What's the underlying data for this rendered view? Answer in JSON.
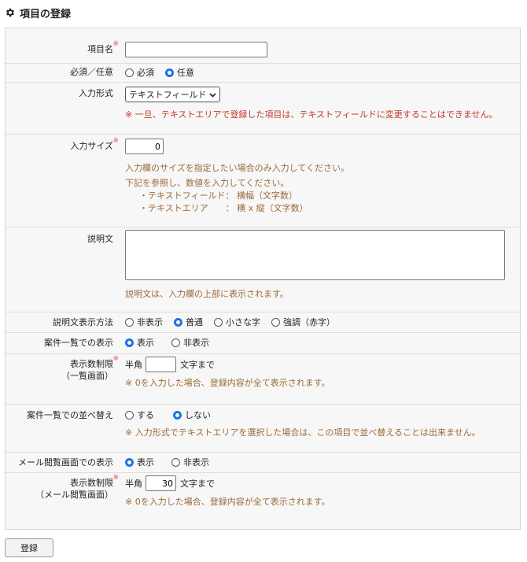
{
  "page": {
    "title": "項目の登録",
    "icon": "gear-icon"
  },
  "required_mark": "※",
  "fields": {
    "item_name": {
      "label": "項目名",
      "value": ""
    },
    "required_optional": {
      "label": "必須／任意",
      "options": [
        "必須",
        "任意"
      ],
      "selected": "任意"
    },
    "input_type": {
      "label": "入力形式",
      "selected": "テキストフィールド",
      "note": "※ 一旦、テキストエリアで登録した項目は、テキストフィールドに変更することはできません。"
    },
    "input_size": {
      "label": "入力サイズ",
      "value": "0",
      "note": "入力欄のサイズを指定したい場合のみ入力してください。",
      "help": "下記を参照し、数値を入力してください。",
      "help_lines": [
        "・テキストフィールド： 横幅（文字数）",
        "・テキストエリア　　： 横 x 縦（文字数）"
      ]
    },
    "description": {
      "label": "説明文",
      "value": "",
      "note": "説明文は、入力欄の上部に表示されます。"
    },
    "description_display": {
      "label": "説明文表示方法",
      "options": [
        "非表示",
        "普通",
        "小さな字",
        "強調（赤字）"
      ],
      "selected": "普通"
    },
    "list_display": {
      "label": "案件一覧での表示",
      "options": [
        "表示",
        "非表示"
      ],
      "selected": "表示"
    },
    "list_char_limit": {
      "label_line1": "表示数制限",
      "label_line2": "（一覧画面）",
      "prefix": "半角",
      "value": "",
      "suffix": "文字まで",
      "note": "※ 0を入力した場合、登録内容が全て表示されます。"
    },
    "list_sort": {
      "label": "案件一覧での並べ替え",
      "options": [
        "する",
        "しない"
      ],
      "selected": "しない",
      "note": "※ 入力形式でテキストエリアを選択した場合は、この項目で並べ替えることは出来ません。"
    },
    "mail_display": {
      "label": "メール閲覧画面での表示",
      "options": [
        "表示",
        "非表示"
      ],
      "selected": "表示"
    },
    "mail_char_limit": {
      "label_line1": "表示数制限",
      "label_line2": "（メール閲覧画面）",
      "prefix": "半角",
      "value": "30",
      "suffix": "文字まで",
      "note": "※ 0を入力した場合、登録内容が全て表示されます。"
    }
  },
  "actions": {
    "submit_label": "登録"
  },
  "colors": {
    "accent": "#1a73e8",
    "warning_note": "#c0392b",
    "info_note": "#9a6a3a",
    "required_mark": "#e0505a"
  }
}
